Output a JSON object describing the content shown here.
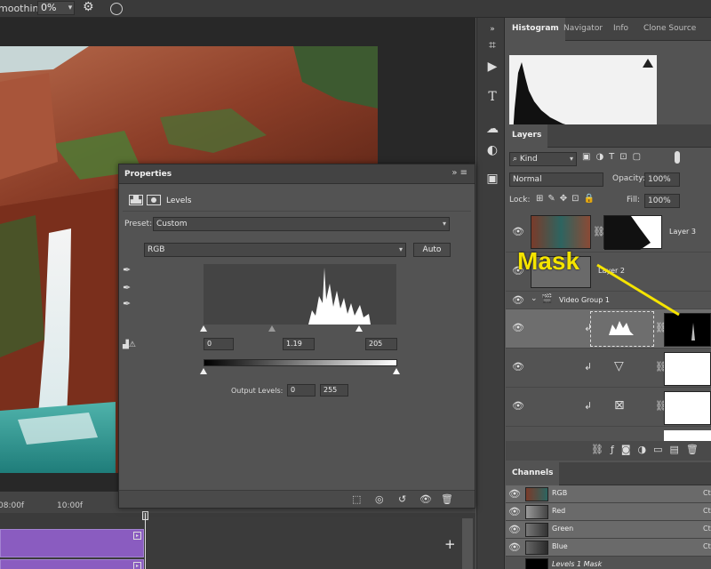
{
  "options_bar": {
    "smoothing_label": "moothing:",
    "smoothing_value": "0%",
    "settings_icon": "gear-icon",
    "airbrush_icon": "airbrush-icon"
  },
  "timeline": {
    "tick_1": "08:00f",
    "tick_2": "10:00f",
    "add_label": "+"
  },
  "right_panels": {
    "tabs": [
      "Histogram",
      "Navigator",
      "Info",
      "Clone Source"
    ],
    "active_tab": "Histogram"
  },
  "layers_panel": {
    "tab": "Layers",
    "filter_label": "Kind",
    "blend_mode": "Normal",
    "opacity_label": "Opacity:",
    "opacity_value": "100%",
    "lock_label": "Lock:",
    "fill_label": "Fill:",
    "fill_value": "100%",
    "layers": [
      {
        "name": "Layer 3",
        "visible": true
      },
      {
        "name": "Layer 2",
        "visible": true
      },
      {
        "name": "Video Group 1",
        "visible": true
      },
      {
        "name": "",
        "visible": true
      },
      {
        "name": "",
        "visible": true
      },
      {
        "name": "",
        "visible": true
      }
    ]
  },
  "channels_panel": {
    "tab": "Channels",
    "channels": [
      {
        "name": "RGB",
        "shortcut": "Ct"
      },
      {
        "name": "Red",
        "shortcut": "Ct"
      },
      {
        "name": "Green",
        "shortcut": "Ct"
      },
      {
        "name": "Blue",
        "shortcut": "Ct"
      },
      {
        "name": "Levels 1 Mask",
        "shortcut": ""
      }
    ]
  },
  "properties": {
    "title": "Properties",
    "adjustment": "Levels",
    "preset_label": "Preset:",
    "preset_value": "Custom",
    "channel_value": "RGB",
    "auto_label": "Auto",
    "input_black": "0",
    "input_gamma": "1.19",
    "input_white": "205",
    "output_label": "Output Levels:",
    "output_black": "0",
    "output_white": "255"
  },
  "annotation": {
    "text": "Mask",
    "color": "#f5e400"
  },
  "colors": {
    "panel_bg": "#535353",
    "dark_bg": "#282828",
    "clip_purple": "#8a5cc0"
  }
}
